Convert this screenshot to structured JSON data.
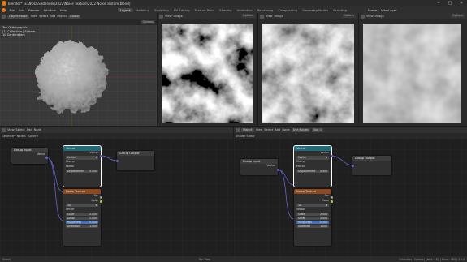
{
  "titlebar": {
    "title": "Blender* [E:\\NODES\\Blender\\2022\\Noise Texture\\2022 Noise Texture.blend]",
    "minimize": "–",
    "maximize": "□",
    "close": "✕"
  },
  "menu": [
    "File",
    "Edit",
    "Render",
    "Window",
    "Help"
  ],
  "workspaces": [
    "Layout",
    "Modeling",
    "Sculpting",
    "UV Editing",
    "Texture Paint",
    "Shading",
    "Animation",
    "Rendering",
    "Compositing",
    "Geometry Nodes",
    "Scripting"
  ],
  "active_workspace": "Layout",
  "scene": {
    "scene_name": "Scene",
    "view_layer": "ViewLayer"
  },
  "viewport3d": {
    "mode": "Object Mode",
    "menus": [
      "View",
      "Select",
      "Add",
      "Object"
    ],
    "transform": "Global",
    "options": "Options",
    "overlay_lines": [
      "Top Orthographic",
      "(1) Collection | Sphere",
      "10 Centimeters"
    ]
  },
  "image_editors": [
    {
      "view": "View",
      "image": "Image",
      "options": "Options"
    },
    {
      "view": "View",
      "image": "Image",
      "options": "Options"
    },
    {
      "view": "View",
      "image": "Image",
      "options": "Options"
    }
  ],
  "left_editor": {
    "editor": "Geometry Nodes",
    "menus": [
      "View",
      "Select",
      "Add",
      "Node"
    ],
    "breadcrumb": "Sphere",
    "nodes": {
      "group_input": {
        "title": "Group Input",
        "out": "Vector"
      },
      "group_output": {
        "title": "Group Output"
      },
      "combine": {
        "title": "Vector",
        "out": "Vector",
        "type": "Vector",
        "clamp": "Clamp",
        "row_label": "Factor",
        "field_label": "Displacement",
        "field_value": "0.500"
      },
      "noise": {
        "title": "Noise Texture",
        "out_fac": "Fac",
        "out_color": "Color",
        "dim": "3D",
        "in_vector": "Vector",
        "fields": [
          {
            "label": "Scale",
            "value": "2.000",
            "hl": false
          },
          {
            "label": "Detail",
            "value": "2.000",
            "hl": false
          },
          {
            "label": "Roughness",
            "value": "0.500",
            "hl": true
          },
          {
            "label": "Distortion",
            "value": "1.000",
            "hl": false
          }
        ]
      }
    }
  },
  "right_editor": {
    "editor": "Shader Editor",
    "menus": [
      "View",
      "Select",
      "Add",
      "Node"
    ],
    "object": "Object",
    "slot": "Slot 1",
    "use_nodes": "Use Nodes",
    "nodes": {
      "input": {
        "title": "Group Input",
        "out": "Vector"
      },
      "output": {
        "title": "Group Output"
      },
      "combine": {
        "title": "Vector",
        "out": "Vector",
        "type": "Vector",
        "clamp": "Clamp",
        "row_label": "Factor",
        "field_label": "Displacement",
        "field_value": "0.500"
      },
      "noise": {
        "title": "Noise Texture",
        "out_fac": "Fac",
        "out_color": "Color",
        "dim": "3D",
        "in_vector": "Vector",
        "fields": [
          {
            "label": "Scale",
            "value": "2.000",
            "hl": false
          },
          {
            "label": "Detail",
            "value": "2.000",
            "hl": false
          },
          {
            "label": "Roughness",
            "value": "0.500",
            "hl": true
          },
          {
            "label": "Distortion",
            "value": "1.000",
            "hl": false
          }
        ]
      }
    }
  },
  "statusbar": {
    "left": "Select",
    "middle": "Pan View",
    "right": "Collection | Sphere | Verts: 482 | Faces: 480 | 3.0.0"
  },
  "colors": {
    "accent": "#4772b3",
    "vector_socket": "#6363c7",
    "float_socket": "#a1a1a1",
    "color_socket": "#c7c729"
  }
}
